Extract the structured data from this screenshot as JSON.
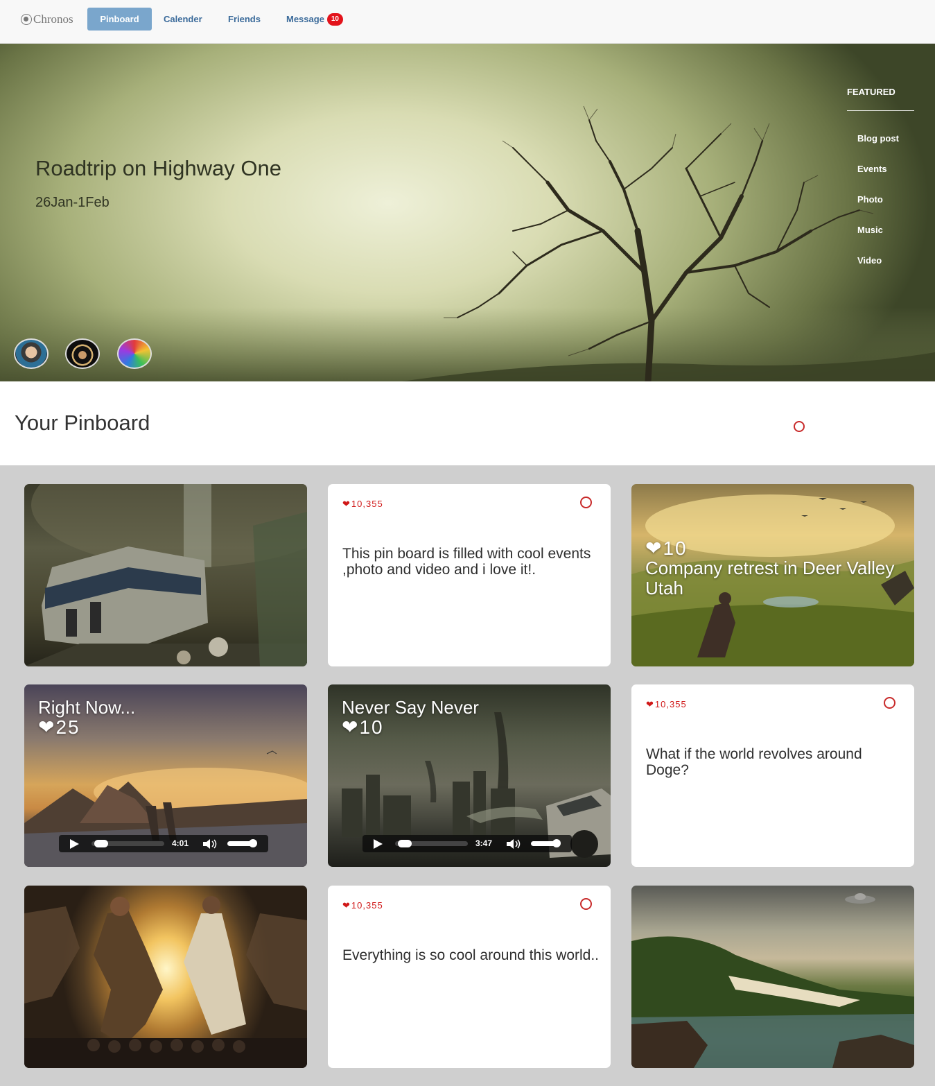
{
  "nav": {
    "brand": "Chronos",
    "items": [
      {
        "label": "Pinboard",
        "active": true
      },
      {
        "label": "Calender",
        "active": false
      },
      {
        "label": "Friends",
        "active": false
      },
      {
        "label": "Message",
        "active": false
      }
    ],
    "message_count": "10"
  },
  "hero": {
    "title": "Roadtrip on Highway One",
    "date": "26Jan-1Feb",
    "featured_heading": "FEATURED",
    "featured_links": [
      "Blog post",
      "Events",
      "Photo",
      "Music",
      "Video"
    ],
    "avatars": [
      "avatar-boy",
      "avatar-wolverine",
      "avatar-lion"
    ]
  },
  "pinboard": {
    "title": "Your Pinboard",
    "cards": [
      {
        "kind": "image",
        "scene": "subway train"
      },
      {
        "kind": "text",
        "likes": "10,355",
        "text": "This pin board is filled with cool events ,photo and video and i love it!."
      },
      {
        "kind": "image-overlay",
        "likes": "10",
        "title": "Company retrest in Deer Valley Utah"
      },
      {
        "kind": "video",
        "title": "Right Now...",
        "likes": "25",
        "time": "4:01"
      },
      {
        "kind": "video",
        "title": "Never Say Never",
        "likes": "10",
        "time": "3:47"
      },
      {
        "kind": "text",
        "likes": "10,355",
        "text": "What if the world revolves around Doge?"
      },
      {
        "kind": "image",
        "scene": "couple running"
      },
      {
        "kind": "text",
        "likes": "10,355",
        "text": "Everything is so cool around this world.."
      },
      {
        "kind": "image",
        "scene": "beach with ufo"
      }
    ]
  },
  "colors": {
    "nav_active_bg": "#7aa6cc",
    "nav_text": "#3a6a9a",
    "badge": "#e3131b",
    "like_red": "#d01818",
    "page_bg": "#cfcfcf"
  },
  "icons": {
    "heart": "heart-icon",
    "ring": "ring-icon",
    "play": "play-icon",
    "volume": "volume-icon"
  }
}
